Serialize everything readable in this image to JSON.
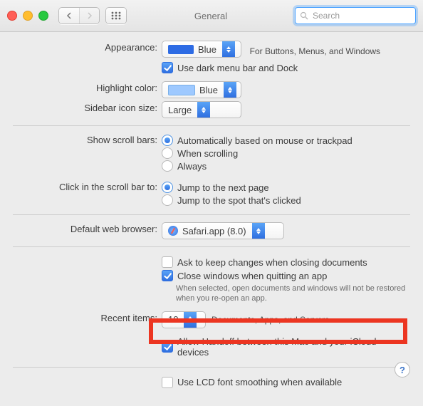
{
  "window": {
    "title": "General"
  },
  "search": {
    "placeholder": "Search"
  },
  "appearance": {
    "label": "Appearance:",
    "value": "Blue",
    "hint": "For Buttons, Menus, and Windows",
    "dark_menubar": {
      "label": "Use dark menu bar and Dock",
      "checked": true
    }
  },
  "highlight": {
    "label": "Highlight color:",
    "value": "Blue"
  },
  "sidebar_size": {
    "label": "Sidebar icon size:",
    "value": "Large"
  },
  "scroll_bars": {
    "label": "Show scroll bars:",
    "options": {
      "auto": "Automatically based on mouse or trackpad",
      "scrolling": "When scrolling",
      "always": "Always"
    },
    "selected": "auto"
  },
  "scroll_click": {
    "label": "Click in the scroll bar to:",
    "options": {
      "next": "Jump to the next page",
      "spot": "Jump to the spot that's clicked"
    },
    "selected": "next"
  },
  "browser": {
    "label": "Default web browser:",
    "value": "Safari.app (8.0)"
  },
  "ask_changes": {
    "label": "Ask to keep changes when closing documents",
    "checked": false
  },
  "close_windows": {
    "label": "Close windows when quitting an app",
    "checked": true,
    "note": "When selected, open documents and windows will not be restored when you re-open an app."
  },
  "recent": {
    "label": "Recent items:",
    "value": "10",
    "after": "Documents, Apps, and Servers"
  },
  "handoff": {
    "label": "Allow Handoff between this Mac and your iCloud devices",
    "checked": true
  },
  "lcd": {
    "label": "Use LCD font smoothing when available",
    "checked": false
  },
  "help": "?"
}
